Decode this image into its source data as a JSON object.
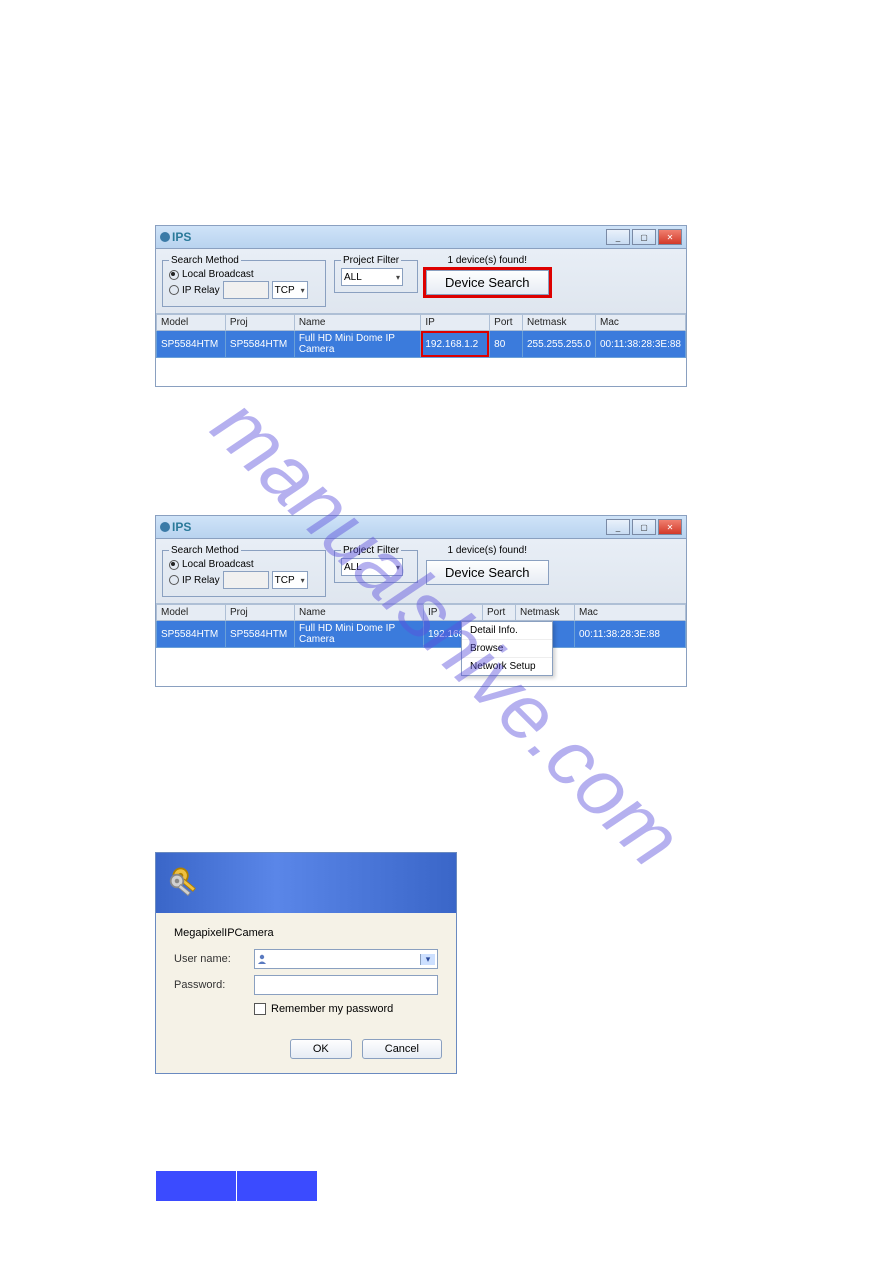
{
  "watermark": "manualshive.com",
  "ips": {
    "title": "IPS",
    "search_method_legend": "Search Method",
    "local_broadcast": "Local Broadcast",
    "ip_relay": "IP Relay",
    "tcp": "TCP",
    "project_filter_legend": "Project Filter",
    "project_filter_value": "ALL",
    "found_label": "1 device(s) found!",
    "device_search": "Device Search",
    "columns": {
      "model": "Model",
      "proj": "Proj",
      "name": "Name",
      "ip": "IP",
      "port": "Port",
      "netmask": "Netmask",
      "mac": "Mac"
    },
    "row": {
      "model": "SP5584HTM",
      "proj": "SP5584HTM",
      "name": "Full HD Mini Dome IP Camera",
      "ip": "192.168.1.2",
      "port": "80",
      "netmask": "255.255.255.0",
      "mac": "00:11:38:28:3E:88"
    },
    "row2_ip": "192.168...",
    "context_menu": {
      "detail": "Detail Info.",
      "browse": "Browse",
      "network": "Network Setup"
    }
  },
  "login": {
    "title": "MegapixelIPCamera",
    "user_label": "User name:",
    "pass_label": "Password:",
    "remember": "Remember my password",
    "ok": "OK",
    "cancel": "Cancel"
  },
  "cred": {
    "user": "",
    "pass": ""
  }
}
